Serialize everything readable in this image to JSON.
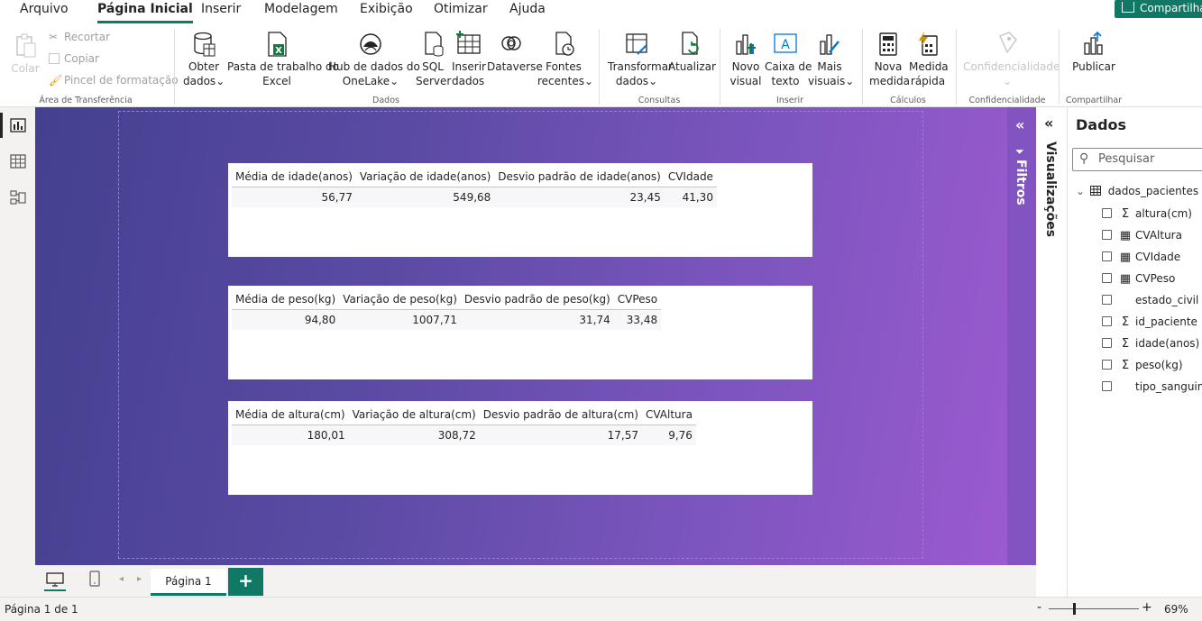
{
  "menu": {
    "items": [
      "Arquivo",
      "Página Inicial",
      "Inserir",
      "Modelagem",
      "Exibição",
      "Otimizar",
      "Ajuda"
    ],
    "active": "Página Inicial",
    "share_label": "Compartilhar"
  },
  "ribbon": {
    "clipboard": {
      "paste": "Colar",
      "cut": "Recortar",
      "copy": "Copiar",
      "format_painter": "Pincel de formatação",
      "group": "Área de Transferência"
    },
    "data": {
      "get_data_1": "Obter",
      "get_data_2": "dados",
      "excel_1": "Pasta de trabalho do",
      "excel_2": "Excel",
      "onelake_1": "Hub de dados do",
      "onelake_2": "OneLake",
      "sql_1": "SQL",
      "sql_2": "Server",
      "enter_1": "Inserir",
      "enter_2": "dados",
      "dataverse": "Dataverse",
      "recent_1": "Fontes",
      "recent_2": "recentes",
      "group": "Dados"
    },
    "queries": {
      "transform_1": "Transformar",
      "transform_2": "dados",
      "refresh": "Atualizar",
      "group": "Consultas"
    },
    "insert": {
      "visual_1": "Novo",
      "visual_2": "visual",
      "textbox_1": "Caixa de",
      "textbox_2": "texto",
      "more_1": "Mais",
      "more_2": "visuais",
      "group": "Inserir"
    },
    "calc": {
      "measure_1": "Nova",
      "measure_2": "medida",
      "quick_1": "Medida",
      "quick_2": "rápida",
      "group": "Cálculos"
    },
    "sensitivity": {
      "label": "Confidencialidade",
      "group": "Confidencialidade"
    },
    "share": {
      "publish": "Publicar",
      "group": "Compartilhar"
    }
  },
  "tables": [
    {
      "headers": [
        "Média de idade(anos)",
        "Variação de idade(anos)",
        "Desvio padrão de idade(anos)",
        "CVIdade"
      ],
      "values": [
        "56,77",
        "549,68",
        "23,45",
        "41,30"
      ]
    },
    {
      "headers": [
        "Média de peso(kg)",
        "Variação de peso(kg)",
        "Desvio padrão de peso(kg)",
        "CVPeso"
      ],
      "values": [
        "94,80",
        "1007,71",
        "31,74",
        "33,48"
      ]
    },
    {
      "headers": [
        "Média de altura(cm)",
        "Variação de altura(cm)",
        "Desvio padrão de altura(cm)",
        "CVAltura"
      ],
      "values": [
        "180,01",
        "308,72",
        "17,57",
        "9,76"
      ]
    }
  ],
  "panes": {
    "filters": "Filtros",
    "visualizations": "Visualizações",
    "data_title": "Dados",
    "search_placeholder": "Pesquisar",
    "table_name": "dados_pacientes",
    "fields": [
      {
        "name": "altura(cm)",
        "type": "sum"
      },
      {
        "name": "CVAltura",
        "type": "calc"
      },
      {
        "name": "CVIdade",
        "type": "calc"
      },
      {
        "name": "CVPeso",
        "type": "calc"
      },
      {
        "name": "estado_civil",
        "type": "text"
      },
      {
        "name": "id_paciente",
        "type": "sum"
      },
      {
        "name": "idade(anos)",
        "type": "sum"
      },
      {
        "name": "peso(kg)",
        "type": "sum"
      },
      {
        "name": "tipo_sanguineo",
        "type": "text"
      }
    ]
  },
  "tabs": {
    "page": "Página 1"
  },
  "status": {
    "page_info": "Página 1 de 1",
    "zoom": "69%"
  },
  "colors": {
    "accent": "#117865",
    "canvas_start": "#44408f",
    "canvas_end": "#9b5ad0",
    "filters_pane": "#8154c2"
  }
}
